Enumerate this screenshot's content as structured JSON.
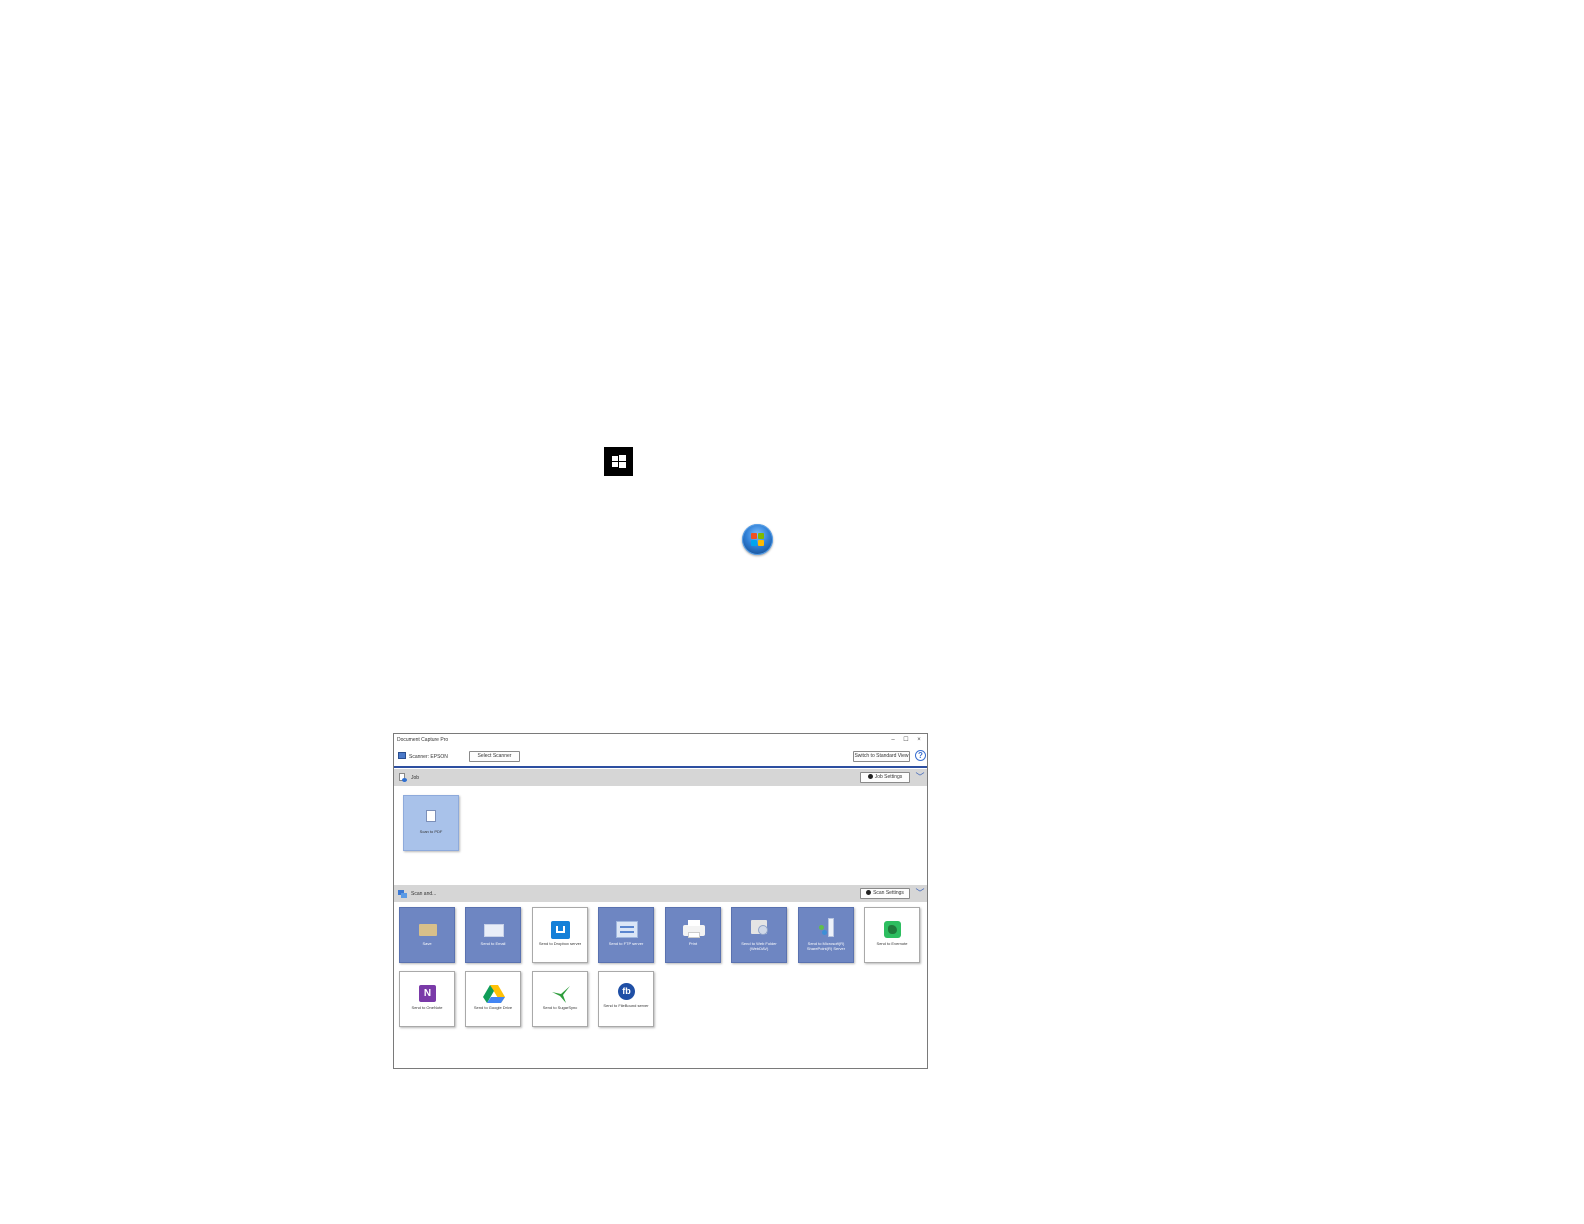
{
  "window": {
    "title": "Document Capture Pro",
    "controls": {
      "minimize": "–",
      "maximize": "☐",
      "close": "×"
    }
  },
  "scanner_row": {
    "scanner_label": "Scanner: EPSON",
    "select_scanner_button": "Select Scanner",
    "switch_view_button": "Switch to Standard View",
    "help": "?"
  },
  "job_section": {
    "label": "Job",
    "settings_button": "Job Settings",
    "tiles": [
      {
        "label": "Scan to PDF",
        "icon": "document-icon"
      }
    ]
  },
  "scan_section": {
    "label": "Scan and...",
    "settings_button": "Scan Settings",
    "tiles": [
      {
        "label": "Save",
        "icon": "folder-icon"
      },
      {
        "label": "Send to Email",
        "icon": "envelope-icon"
      },
      {
        "label": "Send to Dropbox server",
        "icon": "dropbox-icon"
      },
      {
        "label": "Send to FTP server",
        "icon": "ftp-icon"
      },
      {
        "label": "Print",
        "icon": "printer-icon"
      },
      {
        "label": "Send to Web Folder (WebDAV)",
        "icon": "web-folder-icon"
      },
      {
        "label": "Send to Microsoft(R) SharePoint(R) Server",
        "icon": "sharepoint-icon"
      },
      {
        "label": "Send to Evernote",
        "icon": "evernote-icon"
      },
      {
        "label": "Send to OneNote",
        "icon": "onenote-icon"
      },
      {
        "label": "Send to Google Drive",
        "icon": "google-drive-icon"
      },
      {
        "label": "Send to SugarSync",
        "icon": "sugarsync-icon"
      },
      {
        "label": "Send to FileBound server",
        "icon": "filebound-icon"
      }
    ]
  },
  "colors": {
    "accent_blue": "#2d4fa0",
    "tile_blue": "#6e86c2",
    "tile_selected": "#a9c2ea",
    "section_bar": "#d6d6d6"
  }
}
